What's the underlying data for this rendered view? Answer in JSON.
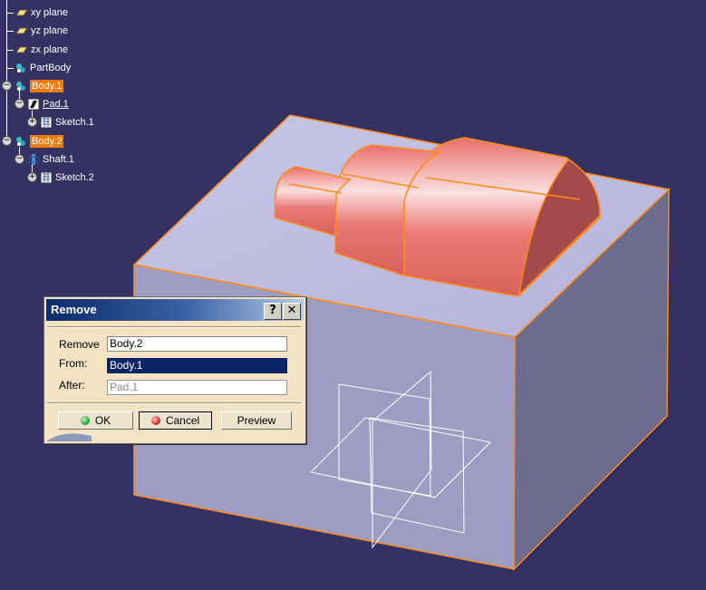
{
  "tree": {
    "items": [
      {
        "label": "xy plane"
      },
      {
        "label": "yz plane"
      },
      {
        "label": "zx plane"
      },
      {
        "label": "PartBody"
      },
      {
        "label": "Body.1"
      },
      {
        "label": "Pad.1"
      },
      {
        "label": "Sketch.1"
      },
      {
        "label": "Body.2"
      },
      {
        "label": "Shaft.1"
      },
      {
        "label": "Sketch.2"
      }
    ]
  },
  "dialog": {
    "title": "Remove",
    "help_glyph": "?",
    "close_glyph": "✕",
    "remove_label": "Remove",
    "remove_value": "Body.2",
    "from_label": "From:",
    "from_value": "Body.1",
    "after_label": "After:",
    "after_value": "Pad.1",
    "ok_label": "OK",
    "cancel_label": "Cancel",
    "preview_label": "Preview"
  },
  "colors": {
    "background": "#343262",
    "active_node": "#ee7a10",
    "box_top": "#bcbce0",
    "box_front": "#9d9dc2",
    "box_right": "#6c6c8c",
    "edge_highlight": "#ff8a1a",
    "shaft": "#e8706a",
    "ok_led": "#2fa84a",
    "cancel_led": "#d83030"
  },
  "icons": {
    "plane": "plane-icon",
    "body": "body-icon",
    "pad": "pad-icon",
    "sketch": "sketch-icon",
    "shaft": "shaft-icon"
  }
}
